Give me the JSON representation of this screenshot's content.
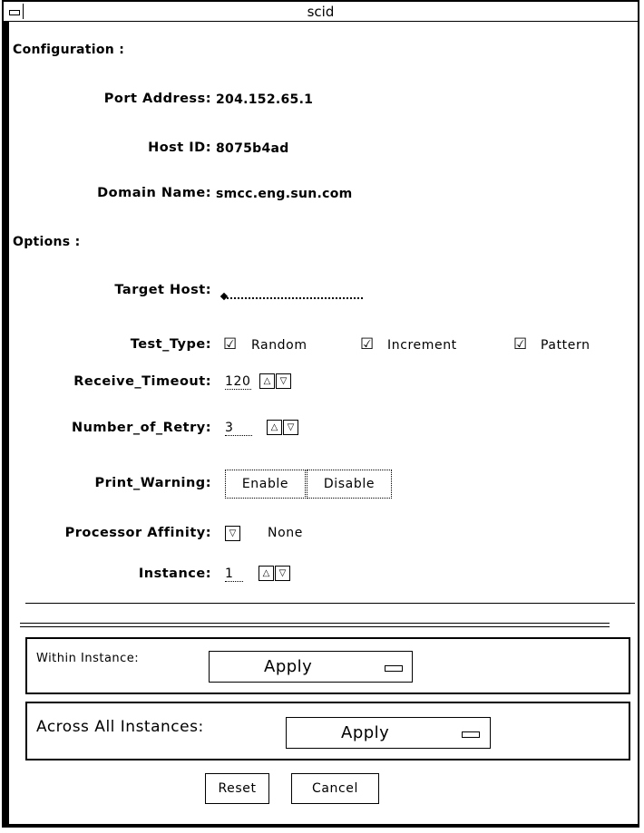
{
  "window": {
    "title": "scid"
  },
  "configuration": {
    "heading": "Configuration :",
    "port_address": {
      "label": "Port Address:",
      "value": "204.152.65.1"
    },
    "host_id": {
      "label": "Host ID:",
      "value": "8075b4ad"
    },
    "domain_name": {
      "label": "Domain Name:",
      "value": "smcc.eng.sun.com"
    }
  },
  "options": {
    "heading": "Options :",
    "target_host": {
      "label": "Target Host:",
      "value": ""
    },
    "test_type": {
      "label": "Test_Type:",
      "choices": [
        {
          "label": "Random",
          "checked": true
        },
        {
          "label": "Increment",
          "checked": true
        },
        {
          "label": "Pattern",
          "checked": true
        }
      ]
    },
    "receive_timeout": {
      "label": "Receive_Timeout:",
      "value": "120"
    },
    "number_of_retry": {
      "label": "Number_of_Retry:",
      "value": "3"
    },
    "print_warning": {
      "label": "Print_Warning:",
      "options": [
        "Enable",
        "Disable"
      ],
      "selected": "Disable"
    },
    "processor_affinity": {
      "label": "Processor Affinity:",
      "value": "None"
    },
    "instance": {
      "label": "Instance:",
      "value": "1"
    }
  },
  "apply_section": {
    "within": {
      "label": "Within Instance:",
      "button": "Apply"
    },
    "across": {
      "label": "Across All Instances:",
      "button": "Apply"
    }
  },
  "buttons": {
    "reset": "Reset",
    "cancel": "Cancel"
  }
}
